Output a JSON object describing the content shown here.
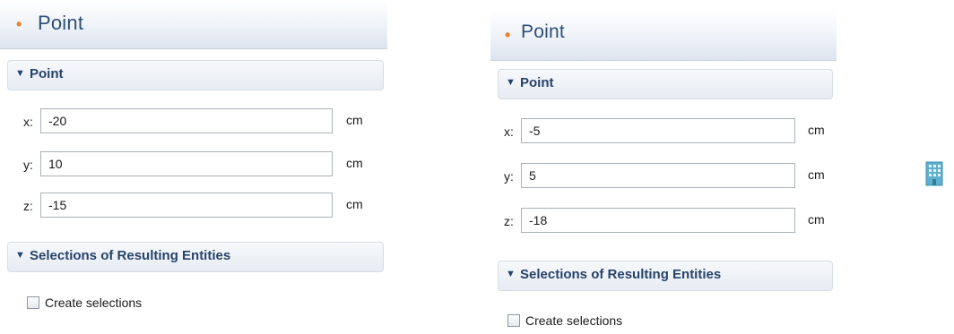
{
  "panels": [
    {
      "title": "Point",
      "point_section": {
        "label": "Point"
      },
      "coords": [
        {
          "axis": "x:",
          "value": "-20",
          "unit": "cm"
        },
        {
          "axis": "y:",
          "value": "10",
          "unit": "cm"
        },
        {
          "axis": "z:",
          "value": "-15",
          "unit": "cm"
        }
      ],
      "selections_section": {
        "label": "Selections of Resulting Entities"
      },
      "create_selections": {
        "label": "Create selections",
        "checked": false
      }
    },
    {
      "title": "Point",
      "point_section": {
        "label": "Point"
      },
      "coords": [
        {
          "axis": "x:",
          "value": "-5",
          "unit": "cm"
        },
        {
          "axis": "y:",
          "value": "5",
          "unit": "cm"
        },
        {
          "axis": "z:",
          "value": "-18",
          "unit": "cm"
        }
      ],
      "selections_section": {
        "label": "Selections of Resulting Entities"
      },
      "create_selections": {
        "label": "Create selections",
        "checked": false
      }
    }
  ],
  "icons": {
    "right_side": "building-icon"
  },
  "colors": {
    "title_dot": "#e8812f",
    "title_text": "#2d4e78",
    "section_text": "#27436a"
  }
}
